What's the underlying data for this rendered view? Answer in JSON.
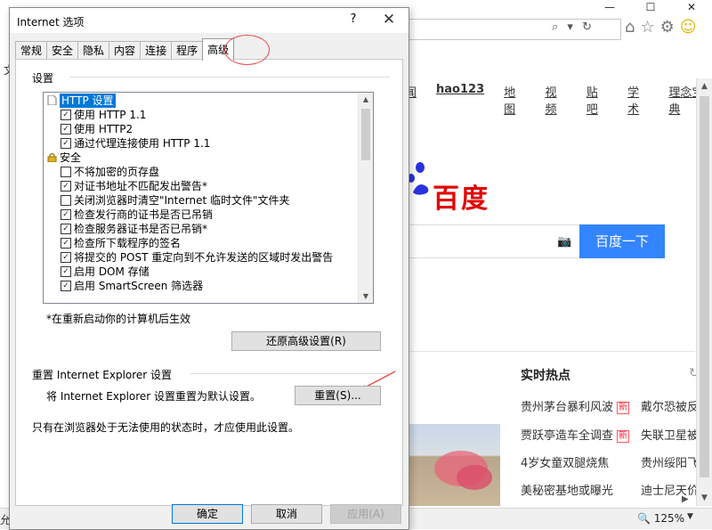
{
  "browser": {
    "window_controls": [
      "—",
      "☐",
      "✕"
    ],
    "address_icons": "⌕ ▾ ↻",
    "toolbar_icons": {
      "home": "⌂",
      "favorites": "☆",
      "settings": "⚙",
      "feedback": "☺"
    },
    "left_menu_char": "文",
    "nav_links": [
      "闻",
      "hao123",
      "地图",
      "视频",
      "贴吧",
      "学术",
      "理念宝典"
    ],
    "logo_word": "百度",
    "search_button": "百度一下",
    "hot_title": "实时热点",
    "hot_items": [
      {
        "text": "贵州茅台暴利风波",
        "badge": "新"
      },
      {
        "text": "戴尔恐被反"
      },
      {
        "text": "贾跃亭造车全调查",
        "badge": "新"
      },
      {
        "text": "失联卫星被"
      },
      {
        "text": "4岁女童双腿烧焦"
      },
      {
        "text": "贵州绥阳飞"
      },
      {
        "text": "美秘密基地或曝光"
      },
      {
        "text": "迪士尼天价"
      }
    ],
    "status_left": "允",
    "zoom": "125%",
    "colors": {
      "search_blue": "#3385ff",
      "baidu_red": "#e10602"
    }
  },
  "dialog": {
    "title": "Internet 选项",
    "help": "?",
    "close": "✕",
    "tabs": [
      "常规",
      "安全",
      "隐私",
      "内容",
      "连接",
      "程序",
      "高级"
    ],
    "active_tab": "高级",
    "settings_group": "设置",
    "tree": [
      {
        "type": "folder",
        "label": "HTTP 设置",
        "selected": true
      },
      {
        "type": "check",
        "label": "使用 HTTP 1.1",
        "checked": true
      },
      {
        "type": "check",
        "label": "使用 HTTP2",
        "checked": true
      },
      {
        "type": "check",
        "label": "通过代理连接使用 HTTP 1.1",
        "checked": true
      },
      {
        "type": "lock",
        "label": "安全"
      },
      {
        "type": "check",
        "label": "不将加密的页存盘",
        "checked": false
      },
      {
        "type": "check",
        "label": "对证书地址不匹配发出警告*",
        "checked": true
      },
      {
        "type": "check",
        "label": "关闭浏览器时清空\"Internet 临时文件\"文件夹",
        "checked": false
      },
      {
        "type": "check",
        "label": "检查发行商的证书是否已吊销",
        "checked": true
      },
      {
        "type": "check",
        "label": "检查服务器证书是否已吊销*",
        "checked": true
      },
      {
        "type": "check",
        "label": "检查所下载程序的签名",
        "checked": true
      },
      {
        "type": "check",
        "label": "将提交的 POST 重定向到不允许发送的区域时发出警告",
        "checked": true
      },
      {
        "type": "check",
        "label": "启用 DOM 存储",
        "checked": true
      },
      {
        "type": "check",
        "label": "启用 SmartScreen 筛选器",
        "checked": true
      }
    ],
    "restart_note": "*在重新启动你的计算机后生效",
    "restore_button": "还原高级设置(R)",
    "reset_group": "重置 Internet Explorer 设置",
    "reset_description": "将 Internet Explorer 设置重置为默认设置。",
    "reset_button": "重置(S)...",
    "reset_note": "只有在浏览器处于无法使用的状态时，才应使用此设置。",
    "ok_button": "确定",
    "cancel_button": "取消",
    "apply_button": "应用(A)",
    "colors": {
      "selection": "#0078d7",
      "annotation": "#e84a4a"
    }
  }
}
